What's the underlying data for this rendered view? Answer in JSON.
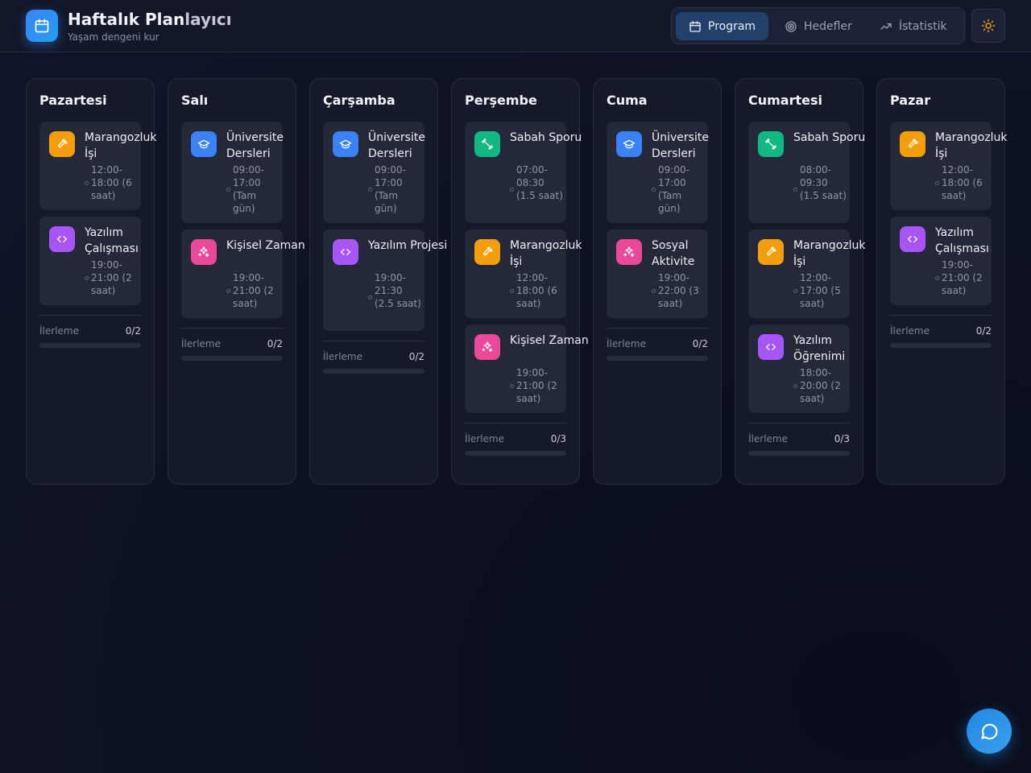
{
  "app": {
    "title_main": "Haftalık Plan",
    "title_fade": "layıcı",
    "subtitle": "Yaşam dengeni kur"
  },
  "nav": {
    "program": "Program",
    "goals": "Hedefler",
    "stats": "İstatistik"
  },
  "colors": {
    "carpentry": "#f59e0b",
    "university": "#3b82f6",
    "coding": "#a855f7",
    "personal": "#ec4899",
    "sport": "#10b981"
  },
  "progress_label": "İlerleme",
  "days": [
    {
      "name": "Pazartesi",
      "progress": "0/2",
      "tasks": [
        {
          "icon": "hammer-icon",
          "color": "carpentry",
          "name": "Marangozluk İşi",
          "time": "12:00-18:00 (6 saat)"
        },
        {
          "icon": "code-icon",
          "color": "coding",
          "name": "Yazılım Çalışması",
          "time": "19:00-21:00 (2 saat)"
        }
      ]
    },
    {
      "name": "Salı",
      "progress": "0/2",
      "tasks": [
        {
          "icon": "graduation-cap-icon",
          "color": "university",
          "name": "Üniversite Dersleri",
          "time": "09:00-17:00 (Tam gün)"
        },
        {
          "icon": "sparkles-icon",
          "color": "personal",
          "name": "Kişisel Zaman",
          "time": "19:00-21:00 (2 saat)"
        }
      ]
    },
    {
      "name": "Çarşamba",
      "progress": "0/2",
      "tasks": [
        {
          "icon": "graduation-cap-icon",
          "color": "university",
          "name": "Üniversite Dersleri",
          "time": "09:00-17:00 (Tam gün)"
        },
        {
          "icon": "code-icon",
          "color": "coding",
          "name": "Yazılım Projesi",
          "time": "19:00-21:30 (2.5 saat)"
        }
      ]
    },
    {
      "name": "Perşembe",
      "progress": "0/3",
      "tasks": [
        {
          "icon": "dumbbell-icon",
          "color": "sport",
          "name": "Sabah Sporu",
          "time": "07:00-08:30 (1.5 saat)"
        },
        {
          "icon": "hammer-icon",
          "color": "carpentry",
          "name": "Marangozluk İşi",
          "time": "12:00-18:00 (6 saat)"
        },
        {
          "icon": "sparkles-icon",
          "color": "personal",
          "name": "Kişisel Zaman",
          "time": "19:00-21:00 (2 saat)"
        }
      ]
    },
    {
      "name": "Cuma",
      "progress": "0/2",
      "tasks": [
        {
          "icon": "graduation-cap-icon",
          "color": "university",
          "name": "Üniversite Dersleri",
          "time": "09:00-17:00 (Tam gün)"
        },
        {
          "icon": "sparkles-icon",
          "color": "personal",
          "name": "Sosyal Aktivite",
          "time": "19:00-22:00 (3 saat)"
        }
      ]
    },
    {
      "name": "Cumartesi",
      "progress": "0/3",
      "tasks": [
        {
          "icon": "dumbbell-icon",
          "color": "sport",
          "name": "Sabah Sporu",
          "time": "08:00-09:30 (1.5 saat)"
        },
        {
          "icon": "hammer-icon",
          "color": "carpentry",
          "name": "Marangozluk İşi",
          "time": "12:00-17:00 (5 saat)"
        },
        {
          "icon": "code-icon",
          "color": "coding",
          "name": "Yazılım Öğrenimi",
          "time": "18:00-20:00 (2 saat)"
        }
      ]
    },
    {
      "name": "Pazar",
      "progress": "0/2",
      "tasks": [
        {
          "icon": "hammer-icon",
          "color": "carpentry",
          "name": "Marangozluk İşi",
          "time": "12:00-18:00 (6 saat)"
        },
        {
          "icon": "code-icon",
          "color": "coding",
          "name": "Yazılım Çalışması",
          "time": "19:00-21:00 (2 saat)"
        }
      ]
    }
  ]
}
